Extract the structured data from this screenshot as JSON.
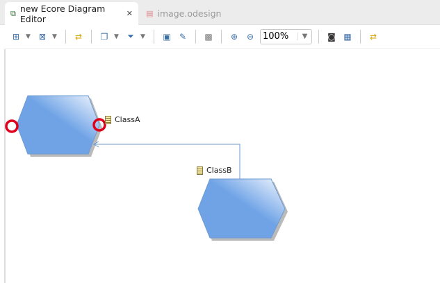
{
  "tabs": [
    {
      "label": "new Ecore Diagram Editor",
      "icon": "diagram-icon",
      "active": true
    },
    {
      "label": "image.odesign",
      "icon": "odesign-file-icon",
      "active": false
    }
  ],
  "toolbar": {
    "zoom_value": "100%"
  },
  "diagram": {
    "nodes": [
      {
        "label": "ClassA"
      },
      {
        "label": "ClassB"
      }
    ],
    "edge": {
      "from": "ClassB",
      "to": "ClassA"
    },
    "colors": {
      "node": "#6fa3e6",
      "edge": "#6e9bd1",
      "highlight": "#e0001b"
    }
  }
}
